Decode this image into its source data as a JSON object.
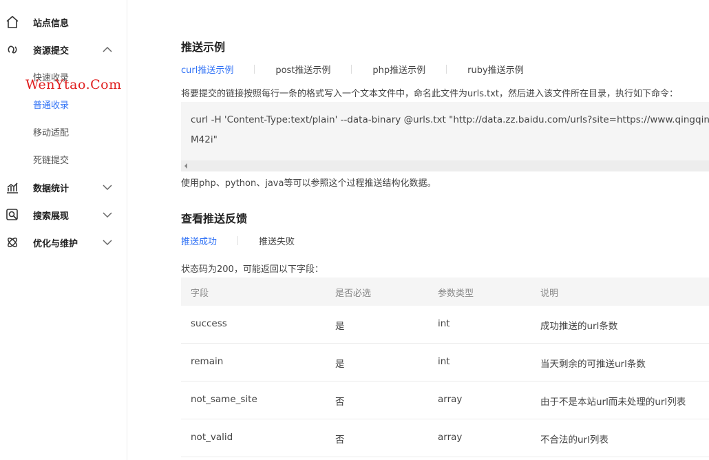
{
  "sidebar": {
    "items": [
      {
        "label": "站点信息",
        "icon": "home-icon"
      },
      {
        "label": "资源提交",
        "icon": "link-icon",
        "expanded": true
      },
      {
        "label": "数据统计",
        "icon": "chart-icon"
      },
      {
        "label": "搜索展现",
        "icon": "search-icon"
      },
      {
        "label": "优化与维护",
        "icon": "atom-icon"
      }
    ],
    "sub_items": [
      "快速收录",
      "普通收录",
      "移动适配",
      "死链提交"
    ],
    "active_sub": "普通收录"
  },
  "watermark": "WenYtao.Com",
  "push_example": {
    "title": "推送示例",
    "tabs": [
      "curl推送示例",
      "post推送示例",
      "php推送示例",
      "ruby推送示例"
    ],
    "instruction": "将要提交的链接按照每行一条的格式写入一个文本文件中，命名此文件为urls.txt，然后进入该文件所在目录，执行如下命令：",
    "code_line1": "curl -H 'Content-Type:text/plain' --data-binary @urls.txt \"http://data.zz.baidu.com/urls?site=https://www.qingqingblog.com",
    "code_line2": "M42i\"",
    "note": "使用php、python、java等可以参照这个过程推送结构化数据。"
  },
  "feedback": {
    "title": "查看推送反馈",
    "tabs": [
      "推送成功",
      "推送失败"
    ],
    "status_text": "状态码为200，可能返回以下字段：",
    "columns": [
      "字段",
      "是否必选",
      "参数类型",
      "说明"
    ],
    "rows": [
      [
        "success",
        "是",
        "int",
        "成功推送的url条数"
      ],
      [
        "remain",
        "是",
        "int",
        "当天剩余的可推送url条数"
      ],
      [
        "not_same_site",
        "否",
        "array",
        "由于不是本站url而未处理的url列表"
      ],
      [
        "not_valid",
        "否",
        "array",
        "不合法的url列表"
      ]
    ]
  },
  "colors": {
    "accent": "#3072f6",
    "watermark": "#e02020"
  }
}
